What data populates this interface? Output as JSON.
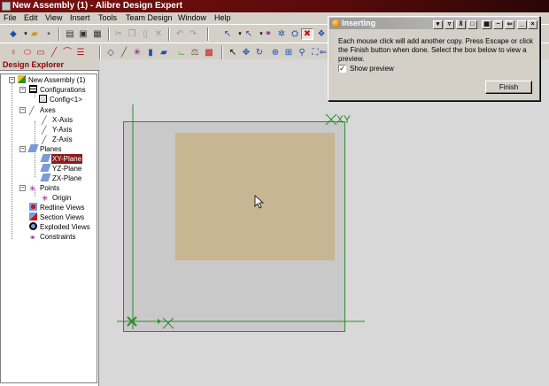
{
  "window": {
    "title": "New Assembly (1) - Alibre Design Expert"
  },
  "menu": [
    "File",
    "Edit",
    "View",
    "Insert",
    "Tools",
    "Team Design",
    "Window",
    "Help"
  ],
  "explorer": {
    "title": "Design Explorer",
    "tree": {
      "root": "New Assembly (1)",
      "configurations": {
        "label": "Configurations",
        "items": [
          "Config<1>"
        ]
      },
      "axes": {
        "label": "Axes",
        "items": [
          "X-Axis",
          "Y-Axis",
          "Z-Axis"
        ]
      },
      "planes": {
        "label": "Planes",
        "items": [
          "XY-Plane",
          "YZ-Plane",
          "ZX-Plane"
        ],
        "selected": "XY-Plane"
      },
      "points": {
        "label": "Points",
        "items": [
          "Origin"
        ]
      },
      "redline_views": "Redline Views",
      "section_views": "Section Views",
      "exploded_views": "Exploded Views",
      "constraints": "Constraints"
    }
  },
  "dialog": {
    "title": "Inserting",
    "message": "Each mouse click will add another copy.  Press Escape or click the Finish button when done.  Select the box below to view a preview.",
    "show_preview_label": "Show preview",
    "show_preview_checked": true,
    "finish_label": "Finish"
  },
  "viewport": {
    "plane_label": "XY",
    "plane_color": "#2c8c2c",
    "block_color": "#c8b592"
  }
}
